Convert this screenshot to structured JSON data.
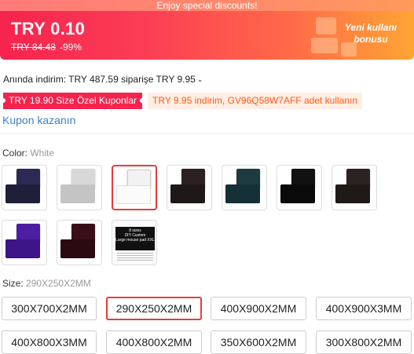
{
  "banner": {
    "text": "Enjoy special discounts!"
  },
  "price": {
    "current": "TRY 0.10",
    "original": "TRY 84.48",
    "discount": "-99%",
    "promo_line1": "Yeni kullanı",
    "promo_line2": "bonusu"
  },
  "instant_discount": {
    "text": "Anında indirim: TRY 487.59 siparişe TRY 9.95"
  },
  "coupons": {
    "special": "TRY 19.90 Size Özel Kuponlar",
    "code": "TRY 9.95 indirim, GV96Q58W7AFF adet kullanın",
    "earn_link": "Kupon kazanın"
  },
  "color": {
    "label": "Color: ",
    "selected": "White",
    "swatch_labels": [
      "8 sizes",
      "DIY Custom",
      "Large mouse pad XXL"
    ]
  },
  "size": {
    "label": "Size: ",
    "selected": "290X250X2MM",
    "options": [
      "300X700X2MM",
      "290X250X2MM",
      "400X900X2MM",
      "400X900X3MM",
      "400X800X3MM",
      "400X800X2MM",
      "350X600X2MM",
      "300X800X2MM"
    ]
  },
  "colors": {
    "accent": "#f5234e",
    "link": "#3f7fc9",
    "coupon_text": "#ff5b1a"
  }
}
